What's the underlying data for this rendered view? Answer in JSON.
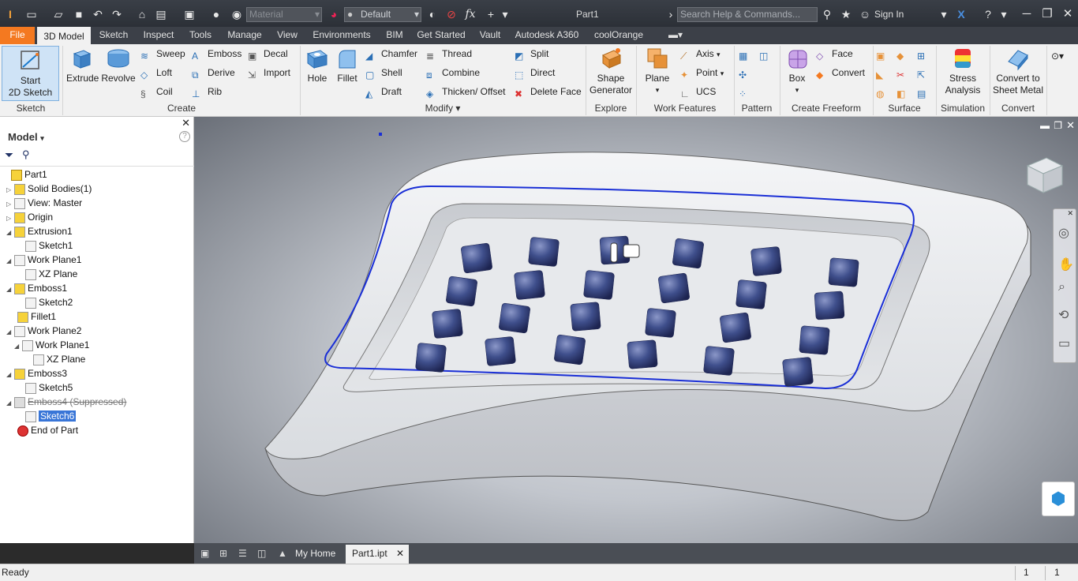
{
  "quick_access": {
    "material_placeholder": "Material",
    "appearance_value": "Default",
    "fx_label": "fx"
  },
  "title": {
    "document": "Part1",
    "help_placeholder": "Search Help & Commands...",
    "sign_in": "Sign In"
  },
  "tabs": [
    "File",
    "3D Model",
    "Sketch",
    "Inspect",
    "Tools",
    "Manage",
    "View",
    "Environments",
    "BIM",
    "Get Started",
    "Vault",
    "Autodesk A360",
    "coolOrange"
  ],
  "ribbon": {
    "sketch": {
      "start_line1": "Start",
      "start_line2": "2D Sketch",
      "label": "Sketch"
    },
    "create": {
      "extrude": "Extrude",
      "revolve": "Revolve",
      "sweep": "Sweep",
      "loft": "Loft",
      "coil": "Coil",
      "emboss": "Emboss",
      "derive": "Derive",
      "rib": "Rib",
      "decal": "Decal",
      "import": "Import",
      "label": "Create"
    },
    "modify": {
      "hole": "Hole",
      "fillet": "Fillet",
      "chamfer": "Chamfer",
      "shell": "Shell",
      "draft": "Draft",
      "thread": "Thread",
      "combine": "Combine",
      "thicken": "Thicken/ Offset",
      "split": "Split",
      "direct": "Direct",
      "delete_face": "Delete Face",
      "label": "Modify"
    },
    "explore": {
      "shape_line1": "Shape",
      "shape_line2": "Generator",
      "label": "Explore"
    },
    "work_features": {
      "plane": "Plane",
      "axis": "Axis",
      "point": "Point",
      "ucs": "UCS",
      "label": "Work Features"
    },
    "pattern": {
      "label": "Pattern"
    },
    "freeform": {
      "box": "Box",
      "face": "Face",
      "convert": "Convert",
      "label": "Create Freeform"
    },
    "surface": {
      "label": "Surface"
    },
    "simulation": {
      "line1": "Stress",
      "line2": "Analysis",
      "label": "Simulation"
    },
    "convert": {
      "line1": "Convert to",
      "line2": "Sheet Metal",
      "label": "Convert"
    }
  },
  "browser": {
    "title": "Model",
    "items": [
      {
        "label": "Part1"
      },
      {
        "label": "Solid Bodies(1)"
      },
      {
        "label": "View: Master"
      },
      {
        "label": "Origin"
      },
      {
        "label": "Extrusion1"
      },
      {
        "label": "Sketch1"
      },
      {
        "label": "Work Plane1"
      },
      {
        "label": "XZ Plane"
      },
      {
        "label": "Emboss1"
      },
      {
        "label": "Sketch2"
      },
      {
        "label": "Fillet1"
      },
      {
        "label": "Work Plane2"
      },
      {
        "label": "Work Plane1"
      },
      {
        "label": "XZ Plane"
      },
      {
        "label": "Emboss3"
      },
      {
        "label": "Sketch5"
      },
      {
        "label": "Emboss4 (Suppressed)"
      },
      {
        "label": "Sketch6"
      },
      {
        "label": "End of Part"
      }
    ]
  },
  "doc_tabs": {
    "home": "My Home",
    "part": "Part1.ipt"
  },
  "status": {
    "text": "Ready",
    "num1": "1",
    "num2": "1"
  },
  "colors": {
    "file_tab": "#f47920",
    "selection": "#3875d7",
    "sketch_line": "#1a2fd6",
    "cube": "#3f4f8c"
  }
}
